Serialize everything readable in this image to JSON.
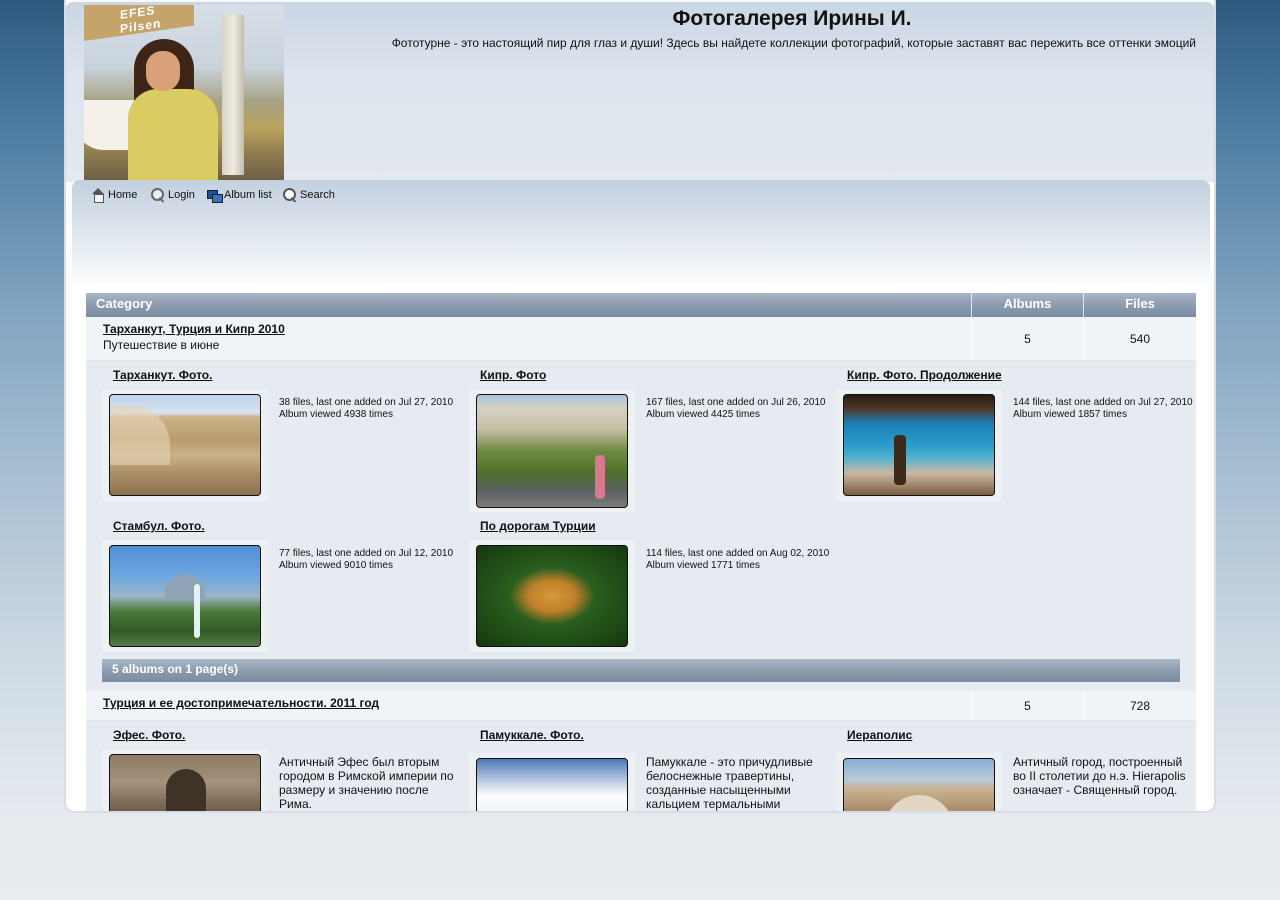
{
  "header": {
    "title": "Фотогалерея Ирины И.",
    "description": "Фототурне - это настоящий пир для глаз и души! Здесь вы найдете коллекции фотографий, которые заставят вас пережить все оттенки эмоций",
    "logo_text": "EFES Pilsen"
  },
  "nav": {
    "items": [
      {
        "label": "Home",
        "icon": "home-icon"
      },
      {
        "label": "Login",
        "icon": "login-icon"
      },
      {
        "label": "Album list",
        "icon": "album-list-icon"
      },
      {
        "label": "Search",
        "icon": "search-icon"
      }
    ]
  },
  "table": {
    "headers": {
      "category": "Category",
      "albums": "Albums",
      "files": "Files"
    },
    "categories": [
      {
        "name": "Тарханкут, Турция и Кипр 2010",
        "subtitle": "Путешествие в июне",
        "albums": "5",
        "files": "540",
        "album_list": [
          {
            "title": "Тарханкут. Фото.",
            "info1": "38 files, last one added on Jul 27, 2010",
            "info2": "Album viewed 4938 times"
          },
          {
            "title": "Кипр. Фото",
            "info1": "167 files, last one added on Jul 26, 2010",
            "info2": "Album viewed 4425 times"
          },
          {
            "title": "Кипр. Фото. Продолжение",
            "info1": "144 files, last one added on Jul 27, 2010",
            "info2": "Album viewed 1857 times"
          },
          {
            "title": "Стамбул. Фото.",
            "info1": "77 files, last one added on Jul 12, 2010",
            "info2": "Album viewed 9010 times"
          },
          {
            "title": "По дорогам Турции",
            "info1": "114 files, last one added on Aug 02, 2010",
            "info2": "Album viewed 1771 times"
          }
        ],
        "footer": "5 albums on 1 page(s)"
      },
      {
        "name": "Турция и ее достопримечательности. 2011 год",
        "albums": "5",
        "files": "728",
        "album_list": [
          {
            "title": "Эфес. Фото.",
            "desc": "Античный Эфес был вторым городом в Римской империи по размеру и значению после Рима."
          },
          {
            "title": "Памуккале. Фото.",
            "desc": "Памуккале - это причудливые белоснежные травертины, созданные насыщенными кальцием термальными источниками."
          },
          {
            "title": "Иераполис",
            "desc": "Античный город, построенный во II столетии до н.э. Hierapolis означает - Священный город."
          }
        ]
      }
    ]
  }
}
